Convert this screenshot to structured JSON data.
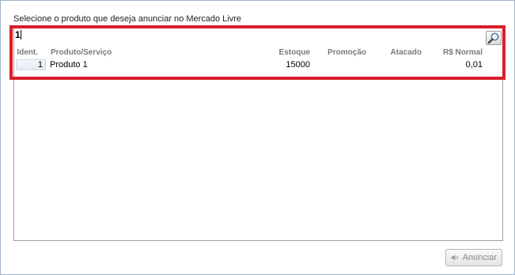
{
  "dialog": {
    "instruction": "Selecione o produto que deseja anunciar no Mercado Livre"
  },
  "search": {
    "value": "1",
    "icon": "magnifier-icon"
  },
  "table": {
    "columns": [
      "Ident.",
      "Produto/Serviço",
      "Estoque",
      "Promoção",
      "Atacado",
      "R$ Normal"
    ],
    "rows": [
      {
        "ident": "1",
        "produto": "Produto 1",
        "estoque": "15000",
        "promocao": "",
        "atacado": "",
        "normal": "0,01"
      }
    ]
  },
  "actions": {
    "announce_label": "Anunciar",
    "announce_icon": "speaker-icon"
  },
  "colors": {
    "highlight": "#d81e2a",
    "window_border": "#9fb3c8"
  }
}
